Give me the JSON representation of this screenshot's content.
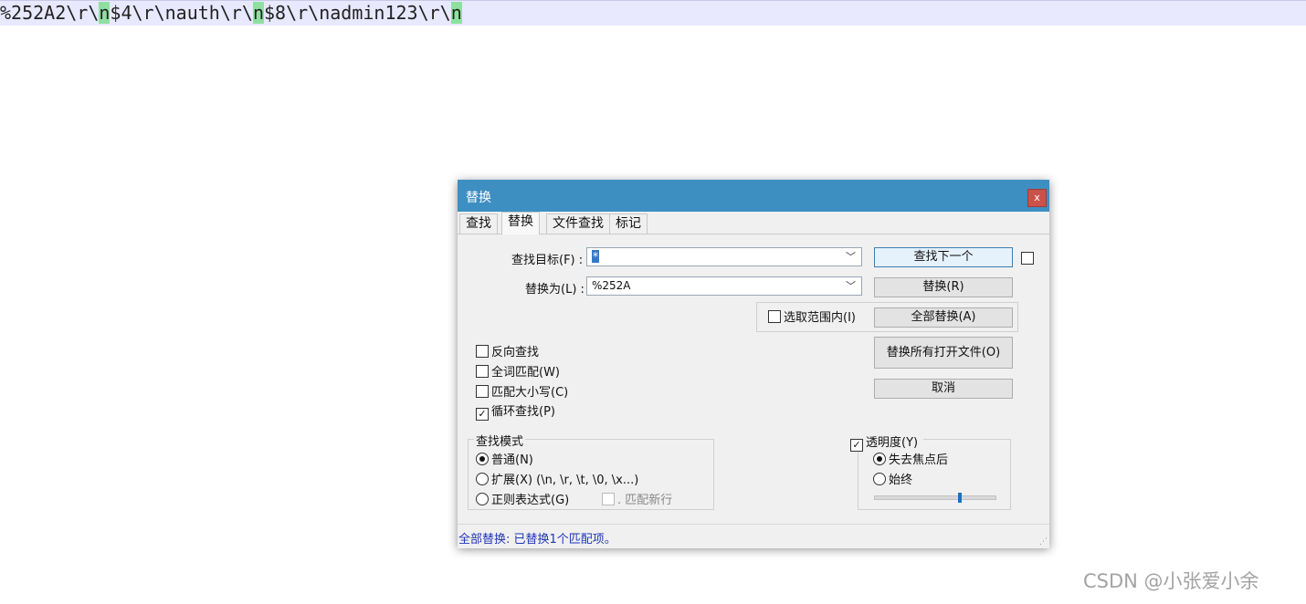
{
  "editor": {
    "segments": [
      {
        "text": "%252A2\\r\\",
        "hl": false
      },
      {
        "text": "n",
        "hl": true
      },
      {
        "text": "$4\\r\\nauth\\r\\",
        "hl": false
      },
      {
        "text": "n",
        "hl": true
      },
      {
        "text": "$8\\r\\nadmin123\\r\\",
        "hl": false
      },
      {
        "text": "n",
        "hl": true
      }
    ]
  },
  "dialog": {
    "title": "替换",
    "close_label": "x",
    "tabs": [
      "查找",
      "替换",
      "文件查找",
      "标记"
    ],
    "find_label": "查找目标(F) :",
    "find_value": "*",
    "replace_label": "替换为(L) :",
    "replace_value": "%252A",
    "in_selection_label": "选取范围内(I)",
    "buttons": {
      "find_next": "查找下一个",
      "replace": "替换(R)",
      "replace_all": "全部替换(A)",
      "replace_all_open": "替换所有打开文件(O)",
      "cancel": "取消"
    },
    "options": [
      {
        "label": "反向查找",
        "checked": false
      },
      {
        "label": "全词匹配(W)",
        "checked": false
      },
      {
        "label": "匹配大小写(C)",
        "checked": false
      },
      {
        "label": "循环查找(P)",
        "checked": true
      }
    ],
    "search_mode": {
      "title": "查找模式",
      "normal": "普通(N)",
      "extended": "扩展(X) (\\n, \\r, \\t, \\0, \\x...)",
      "regex": "正则表达式(G)",
      "dot_newline": ". 匹配新行",
      "selected": "normal"
    },
    "transparency": {
      "title": "透明度(Y)",
      "checked": true,
      "on_lose_focus": "失去焦点后",
      "always": "始终",
      "selected": "on_lose_focus",
      "level": 0.7
    },
    "status": "全部替换: 已替换1个匹配项。"
  },
  "watermark": "CSDN @小张爱小余"
}
